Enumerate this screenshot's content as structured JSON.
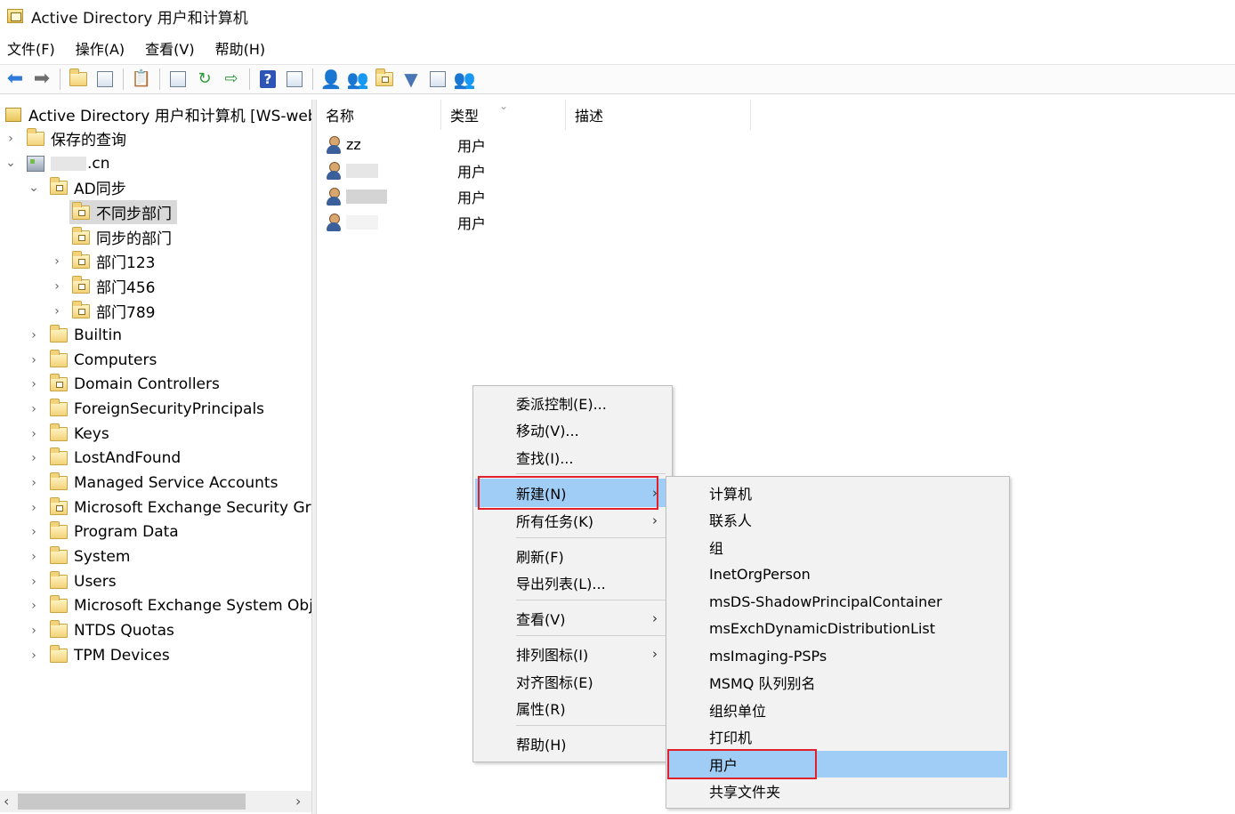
{
  "window": {
    "title": "Active Directory 用户和计算机"
  },
  "menubar": [
    "文件(F)",
    "操作(A)",
    "查看(V)",
    "帮助(H)"
  ],
  "toolbar": [
    {
      "icon": "back-arrow-icon"
    },
    {
      "icon": "forward-arrow-icon"
    },
    {
      "icon": "up-folder-icon"
    },
    {
      "icon": "show-tree-icon"
    },
    {
      "icon": "clipboard-icon"
    },
    {
      "icon": "properties-icon"
    },
    {
      "icon": "refresh-icon"
    },
    {
      "icon": "export-list-icon"
    },
    {
      "icon": "help-icon"
    },
    {
      "icon": "console-tree-icon"
    },
    {
      "icon": "new-user-icon"
    },
    {
      "icon": "new-group-icon"
    },
    {
      "icon": "new-ou-icon"
    },
    {
      "icon": "filter-icon"
    },
    {
      "icon": "find-icon"
    },
    {
      "icon": "add-to-group-icon"
    }
  ],
  "tree": {
    "root": "Active Directory 用户和计算机 [WS-web.c",
    "saved_queries": "保存的查询",
    "domain_suffix": ".cn",
    "ad_sync": "AD同步",
    "ad_sync_children": [
      "不同步部门",
      "同步的部门",
      "部门123",
      "部门456",
      "部门789"
    ],
    "containers": [
      "Builtin",
      "Computers",
      "Domain Controllers",
      "ForeignSecurityPrincipals",
      "Keys",
      "LostAndFound",
      "Managed Service Accounts",
      "Microsoft Exchange Security Gro",
      "Program Data",
      "System",
      "Users",
      "Microsoft Exchange System Obje",
      "NTDS Quotas",
      "TPM Devices"
    ]
  },
  "list": {
    "columns": [
      "名称",
      "类型",
      "描述"
    ],
    "rows": [
      {
        "name": "zz",
        "type": "用户"
      },
      {
        "name": "",
        "type": "用户"
      },
      {
        "name": "",
        "type": "用户"
      },
      {
        "name": "",
        "type": "用户"
      }
    ]
  },
  "context_menu": [
    "委派控制(E)...",
    "移动(V)...",
    "查找(I)...",
    "新建(N)",
    "所有任务(K)",
    "刷新(F)",
    "导出列表(L)...",
    "查看(V)",
    "排列图标(I)",
    "对齐图标(E)",
    "属性(R)",
    "帮助(H)"
  ],
  "submenu": [
    "计算机",
    "联系人",
    "组",
    "InetOrgPerson",
    "msDS-ShadowPrincipalContainer",
    "msExchDynamicDistributionList",
    "msImaging-PSPs",
    "MSMQ 队列别名",
    "组织单位",
    "打印机",
    "用户",
    "共享文件夹"
  ],
  "colors": {
    "highlight": "#9fcdf5",
    "callout_red": "#e0202a"
  }
}
